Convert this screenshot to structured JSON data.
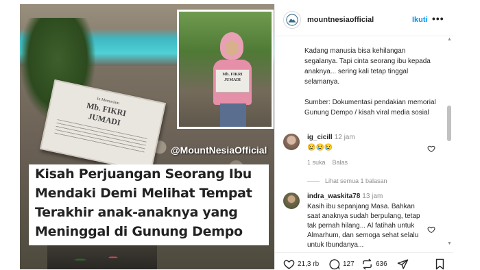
{
  "post": {
    "watermark": "@MountNesiaOfficial",
    "plaque": {
      "top_text": "In Memoriam",
      "name_line1": "Mb. FIKRI",
      "name_line2": "JUMADI"
    },
    "inset_sign": {
      "line1": "Mb. FIKRI",
      "line2": "JUMADI"
    },
    "headline_lines": [
      "Kisah Perjuangan Seorang Ibu",
      "Mendaki Demi Melihat Tempat",
      "Terakhir anak-anaknya yang",
      "Meninggal di Gunung Dempo"
    ]
  },
  "header": {
    "username": "mountnesiaofficial",
    "follow_label": "Ikuti",
    "more_label": "•••"
  },
  "caption": {
    "paragraph1": "Kadang manusia bisa kehilangan segalanya. Tapi cinta seorang ibu kepada anaknya... sering kali tetap tinggal selamanya.",
    "paragraph2": "Sumber: Dokumentasi pendakian memorial Gunung Dempo / kisah viral media sosial"
  },
  "comments": [
    {
      "username": "ig_cicill",
      "time": "12 jam",
      "text": "😢😢😢",
      "likes": "1 suka",
      "reply_label": "Balas"
    },
    {
      "username": "indra_waskita78",
      "time": "13 jam",
      "text": "Kasih ibu sepanjang Masa. Bahkan saat anaknya sudah berpulang, tetap tak pernah hilang... Al fatihah untuk Almarhum, dan semoga sehat selalu untuk Ibundanya..."
    }
  ],
  "view_replies_label": "Lihat semua 1 balasan",
  "actions": {
    "like_count": "21,3 rb",
    "comment_count": "127",
    "repost_count": "636"
  },
  "colors": {
    "link_blue": "#0095f6",
    "text": "#262626",
    "muted": "#8e8e8e"
  }
}
